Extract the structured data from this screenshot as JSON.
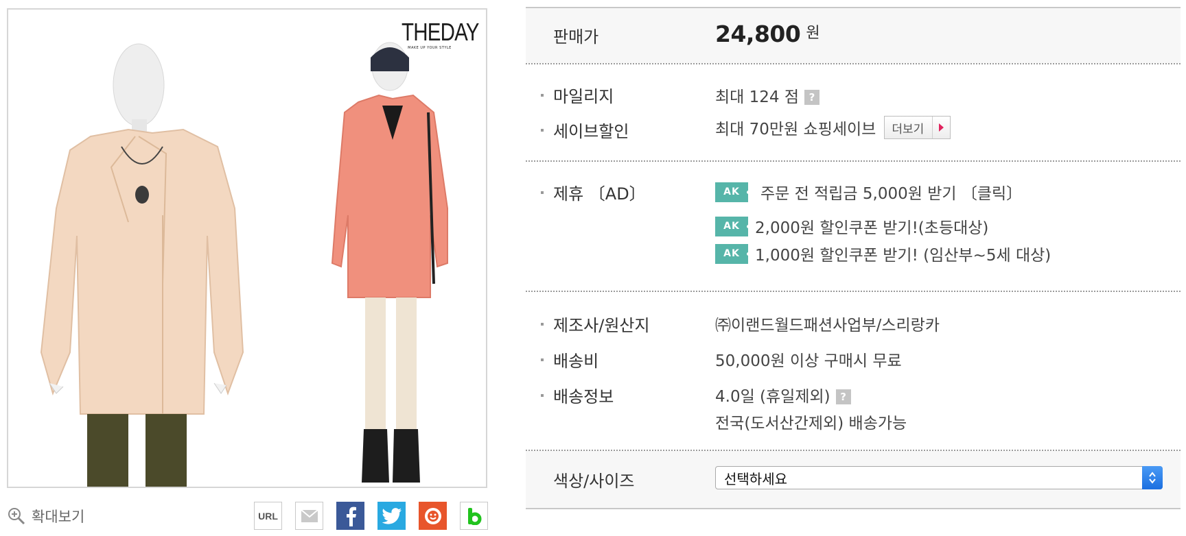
{
  "brand": {
    "logo_text": "THEDAY",
    "logo_tagline": "MAKE UP YOUR STYLE"
  },
  "zoom": {
    "label": "확대보기"
  },
  "share": {
    "url_label": "URL"
  },
  "price": {
    "label": "판매가",
    "amount": "24,800",
    "unit": "원"
  },
  "mileage": {
    "label": "마일리지",
    "value": "최대 124 점",
    "help": "?"
  },
  "save_discount": {
    "label": "세이브할인",
    "value": "최대 70만원 쇼핑세이브",
    "more_label": "더보기"
  },
  "affiliate": {
    "label": "제휴 〔AD〕",
    "badge": "AK",
    "items": [
      "주문 전 적립금 5,000원 받기 〔클릭〕",
      "2,000원 할인쿠폰 받기!(초등대상)",
      "1,000원 할인쿠폰 받기! (임산부~5세 대상)"
    ]
  },
  "maker": {
    "label": "제조사/원산지",
    "value": "㈜이랜드월드패션사업부/스리랑카"
  },
  "shipping_fee": {
    "label": "배송비",
    "value": "50,000원 이상 구매시 무료"
  },
  "shipping_info": {
    "label": "배송정보",
    "line1": "4.0일 (휴일제외)",
    "line2": "전국(도서산간제외) 배송가능",
    "help": "?"
  },
  "options": {
    "label": "색상/사이즈",
    "selected": "선택하세요"
  },
  "colors": {
    "accent_teal": "#56b5a9",
    "facebook": "#3b5998",
    "twitter": "#29a9e1",
    "kakao_story": "#e8552b",
    "select_blue": "#1b6fe0",
    "arrow_pink": "#e0245e"
  }
}
